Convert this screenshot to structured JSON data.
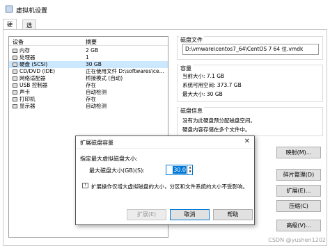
{
  "window": {
    "title": "虚拟机设置"
  },
  "tabs": [
    {
      "label": "硬件"
    },
    {
      "label": "选项"
    }
  ],
  "device_list": {
    "headers": {
      "device": "设备",
      "summary": "摘要"
    },
    "rows": [
      {
        "name": "内存",
        "summary": "2 GB",
        "icon": "memory-icon"
      },
      {
        "name": "处理器",
        "summary": "1",
        "icon": "cpu-icon"
      },
      {
        "name": "硬盘 (SCSI)",
        "summary": "30 GB",
        "icon": "hard-disk-icon"
      },
      {
        "name": "CD/DVD (IDE)",
        "summary": "正在使用文件 D:\\softwares\\ce...",
        "icon": "cd-dvd-icon"
      },
      {
        "name": "网络适配器",
        "summary": "桥接模式 (自动)",
        "icon": "network-adapter-icon"
      },
      {
        "name": "USB 控制器",
        "summary": "存在",
        "icon": "usb-icon"
      },
      {
        "name": "声卡",
        "summary": "自动检测",
        "icon": "sound-card-icon"
      },
      {
        "name": "打印机",
        "summary": "存在",
        "icon": "printer-icon"
      },
      {
        "name": "显示器",
        "summary": "自动检测",
        "icon": "display-icon"
      }
    ]
  },
  "disk_file": {
    "label": "磁盘文件",
    "value": "D:\\vmware\\centos7_64\\CentOS 7 64 位.vmdk"
  },
  "capacity": {
    "label": "容量",
    "current_size": "当前大小: 7.1 GB",
    "system_free": "系统可用空间: 373.7 GB",
    "max_size": "最大大小: 30 GB"
  },
  "disk_info": {
    "label": "磁盘信息",
    "line1": "没有为此硬盘预分配磁盘空间。",
    "line2": "硬盘内容存储在多个文件中。"
  },
  "buttons": {
    "map": "映射(M)...",
    "defrag": "碎片整理(D)",
    "expand": "扩展(E)...",
    "compact": "压缩(C)",
    "advanced": "高级(V)..."
  },
  "dialog": {
    "title": "扩展磁盘容量",
    "close": "✕",
    "prompt": "指定最大虚拟磁盘大小:",
    "size_label": "最大磁盘大小(GB)(S):",
    "size_value": "30.0",
    "hint": "扩展操作仅增大虚拟磁盘的大小，分区和文件系统的大小不受影响。",
    "expand_button": "扩展(E)",
    "cancel_button": "取消",
    "help_button": "帮助"
  },
  "watermark": "CSDN @yushen1202"
}
